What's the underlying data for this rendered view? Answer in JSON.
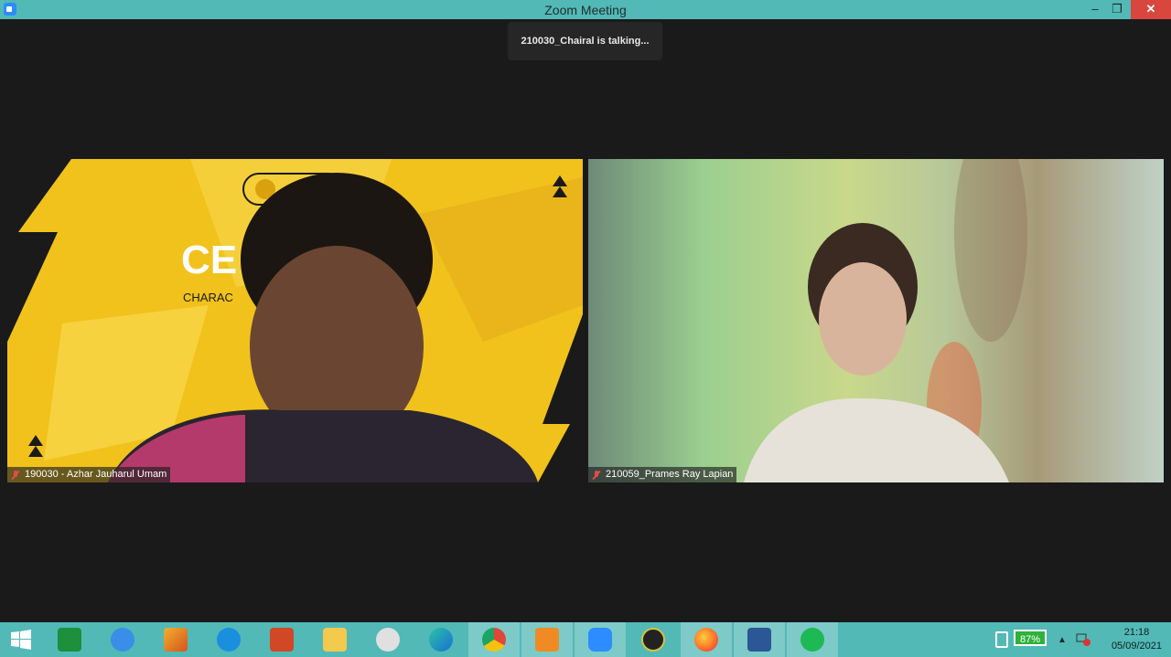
{
  "window": {
    "title": "Zoom Meeting",
    "minimize": "–",
    "maximize": "❐",
    "close": "✕"
  },
  "toast": {
    "text": "210030_Chairal is talking..."
  },
  "participants": [
    {
      "name": "190030 - Azhar Jauharul Umam",
      "muted": true
    },
    {
      "name": "210059_Prames Ray Lapian",
      "muted": true
    }
  ],
  "background_text": {
    "headline": "CE",
    "sub": "CHARAC"
  },
  "taskbar": {
    "apps": [
      {
        "icon": "windows-start-icon",
        "color": "#ffffff"
      },
      {
        "icon": "excel-like-green-icon",
        "color": "#1e8f3a"
      },
      {
        "icon": "chromium-icon",
        "color": "#3b8ee8"
      },
      {
        "icon": "matlab-icon",
        "color": "#d6541c"
      },
      {
        "icon": "internet-explorer-icon",
        "color": "#1a8fe0"
      },
      {
        "icon": "powerpoint-icon",
        "color": "#d24726"
      },
      {
        "icon": "file-explorer-icon",
        "color": "#f3c94e"
      },
      {
        "icon": "paint-icon",
        "color": "#e0e0e0"
      },
      {
        "icon": "edge-icon",
        "color": "#1fa3a8"
      },
      {
        "icon": "chrome-icon",
        "color": "#e0463a"
      },
      {
        "icon": "sublime-text-icon",
        "color": "#f08a24"
      },
      {
        "icon": "zoom-icon",
        "color": "#2d8cff"
      },
      {
        "icon": "network-monitor-icon",
        "color": "#222222"
      },
      {
        "icon": "firefox-icon",
        "color": "#ff6a2b"
      },
      {
        "icon": "word-icon",
        "color": "#2b5797"
      },
      {
        "icon": "spotify-icon",
        "color": "#1db954"
      }
    ],
    "battery": "87%",
    "time": "21:18",
    "date": "05/09/2021"
  }
}
